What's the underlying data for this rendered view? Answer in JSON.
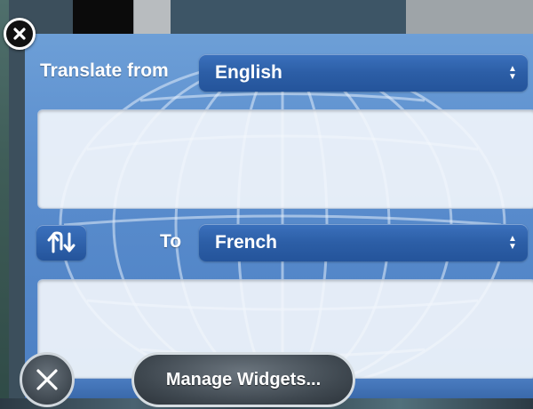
{
  "widget": {
    "from_label": "Translate from",
    "from_language": "English",
    "to_label": "To",
    "to_language": "French",
    "source_text": "",
    "target_text": ""
  },
  "dashboard": {
    "manage_label": "Manage Widgets..."
  },
  "icons": {
    "close_badge": "close-icon",
    "swap": "swap-direction-icon",
    "dashboard_close": "close-icon",
    "select_arrows": "up-down-arrows-icon",
    "background": "globe-icon"
  },
  "colors": {
    "widget_blue": "#5b8ece",
    "select_blue": "#2c5ea6"
  }
}
